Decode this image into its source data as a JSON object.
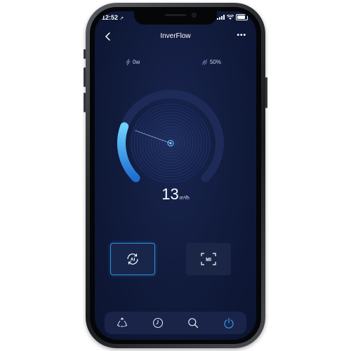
{
  "status_bar": {
    "time": "12:52",
    "location_glyph": "➚"
  },
  "header": {
    "title": "InverFlow",
    "more_label": "•••"
  },
  "stats": {
    "power": "0w",
    "speed": "50%"
  },
  "flow": {
    "value": "13",
    "unit": "m³/h",
    "level_fraction": 0.24
  },
  "modes": {
    "ai_label": "AI",
    "mi_label": "MI"
  },
  "nav": {
    "tabs": [
      "recycle-icon",
      "clock-icon",
      "search-icon",
      "power-icon"
    ]
  },
  "colors": {
    "accent": "#2f8fe0",
    "background": "#101a3a",
    "active_tab": "#2f8fe0"
  }
}
